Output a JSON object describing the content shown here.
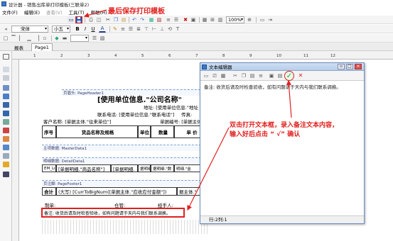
{
  "window": {
    "title": "设计器 - 销售出库单打印模板(三联单2)"
  },
  "menu": [
    "文件(F)",
    "编辑(E)",
    "查看(V)",
    "工具(T)",
    "帮助(H)"
  ],
  "font": {
    "family": "宋体",
    "size": "小五"
  },
  "format_buttons": {
    "bold": "B",
    "italic": "I",
    "underline": "U",
    "color": "A"
  },
  "zoom": "100%",
  "tabs": [
    "报表",
    "Page1"
  ],
  "ruler_marks": [
    "1",
    "2",
    "3",
    "4",
    "5",
    "6",
    "7",
    "8",
    "9",
    "10",
    "11",
    "12"
  ],
  "report": {
    "page_header": "页眉头: PageHeader1",
    "title": "[使用单位信息.\"公司名称\"",
    "addr": "地址: [使用单位信息.\"地址",
    "phone": "联系电话: [使用单位信息.\"联系电话\"]",
    "fax": "传真:",
    "customer": "客户名称: [单据主体.\"往来单位\"]",
    "billno": "单据编号: [单据主体.\"单",
    "col_no": "序号",
    "col_name": "货品名称及规格",
    "col_unit": "单位",
    "col_qty": "数量",
    "col_price": "单 价",
    "master_band": "主项数据: MasterData1",
    "detail_band": "明细数据: DetailData1",
    "detail_no": "EM_Lis",
    "detail_name": "[单据明细.\"商品名称\"]",
    "detail_spec": "[单据明细.",
    "detail_unit": "据明细.\"",
    "detail_qty": "据明细.\"数",
    "detail_price": "明细.\"金",
    "footer_band": "页注脚: PageFooter1",
    "total_label": "合计",
    "total_expr": "(大写) [CurrToBigNum([单据主体.\"应收应付金额\"])",
    "total_tail": "据主体.\"",
    "maker": "制单:",
    "warehouse": "仓管:",
    "handler": "经手人:",
    "remark_field": "备注: 收货后请及时检查验收，如有问题请于天内与我们联系调换。"
  },
  "dialog": {
    "title": "文本编辑器",
    "content": "备注: 收货后请及时检查验收，如有问题请于天内与我们联系调换。",
    "status": "行:2列:1",
    "ok": "✓",
    "cancel": "✕"
  },
  "annotations": {
    "save_tip": "最后保存打印模板",
    "open_tip_1": "双击打开文本框，录入备注文本内容，",
    "open_tip_2": "输入好后点击 “ √” 确认"
  },
  "colors": {
    "annotation": "#e0201e",
    "save_button": "#1e5bb8"
  }
}
